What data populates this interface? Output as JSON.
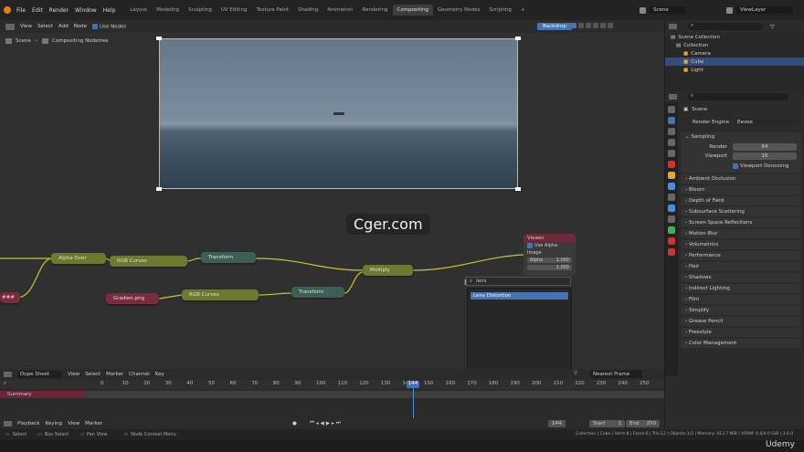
{
  "menus": [
    "File",
    "Edit",
    "Render",
    "Window",
    "Help"
  ],
  "workspaces": [
    "Layout",
    "Modeling",
    "Sculpting",
    "UV Editing",
    "Texture Paint",
    "Shading",
    "Animation",
    "Rendering",
    "Compositing",
    "Geometry Nodes",
    "Scripting"
  ],
  "active_workspace_index": 8,
  "scene_label": "Scene",
  "viewlayer_label": "ViewLayer",
  "node_editor": {
    "menus": [
      "View",
      "Select",
      "Add",
      "Node"
    ],
    "use_nodes_label": "Use Nodes",
    "backdrop_label": "Backdrop",
    "breadcrumb_scene": "Scene",
    "breadcrumb_tree": "Compositing Nodetree"
  },
  "nodes": {
    "hash": "###",
    "alpha_over": "Alpha Over",
    "rgb_curves_1": "RGB Curves",
    "transform_1": "Transform",
    "multiply": "Multiply",
    "gradien": "Gradien.png",
    "rgb_curves_2": "RGB Curves",
    "transform_2": "Transform"
  },
  "viewer": {
    "title": "Viewer",
    "use_alpha": "Use Alpha",
    "image_label": "Image",
    "alpha_label": "Alpha",
    "alpha_value": "1.000",
    "z_value": "1.000"
  },
  "search": {
    "query": "lens",
    "result": "Lens Distortion"
  },
  "watermark": "Cger.com",
  "dopesheet": {
    "mode": "Dope Sheet",
    "menus": [
      "View",
      "Select",
      "Marker",
      "Channel",
      "Key"
    ],
    "snap": "Nearest Frame",
    "summary": "Summary",
    "ticks": [
      "0",
      "10",
      "20",
      "30",
      "40",
      "50",
      "60",
      "70",
      "80",
      "90",
      "100",
      "110",
      "120",
      "130",
      "140",
      "150",
      "160",
      "170",
      "180",
      "190",
      "200",
      "210",
      "220",
      "230",
      "240",
      "250"
    ],
    "current_frame": "144"
  },
  "timeline": {
    "menus": [
      "Playback",
      "Keying",
      "View",
      "Marker"
    ],
    "current": "144",
    "start_label": "Start",
    "start": "1",
    "end_label": "End",
    "end": "250"
  },
  "status": {
    "select": "Select",
    "box_select": "Box Select",
    "pan_view": "Pan View",
    "context_menu": "Node Context Menu",
    "stats": "Collection | Cube | Verts:8 | Faces:6 | Tris:12 | Objects:1/3 | Memory: 413.7 MiB | VRAM: 0.6/4.0 GiB | 3.0.0",
    "brand": "Udemy"
  },
  "outliner": {
    "root": "Scene Collection",
    "collection": "Collection",
    "items": [
      "Camera",
      "Cube",
      "Light"
    ]
  },
  "properties": {
    "scene": "Scene",
    "render_engine_label": "Render Engine",
    "render_engine": "Eevee",
    "sampling": "Sampling",
    "render_label": "Render",
    "render_value": "64",
    "viewport_label": "Viewport",
    "viewport_value": "16",
    "viewport_denoising": "Viewport Denoising",
    "panels": [
      "Ambient Occlusion",
      "Bloom",
      "Depth of Field",
      "Subsurface Scattering",
      "Screen Space Reflections",
      "Motion Blur",
      "Volumetrics",
      "Performance",
      "Hair",
      "Shadows",
      "Indirect Lighting",
      "Film",
      "Simplify",
      "Grease Pencil",
      "Freestyle",
      "Color Management"
    ]
  }
}
